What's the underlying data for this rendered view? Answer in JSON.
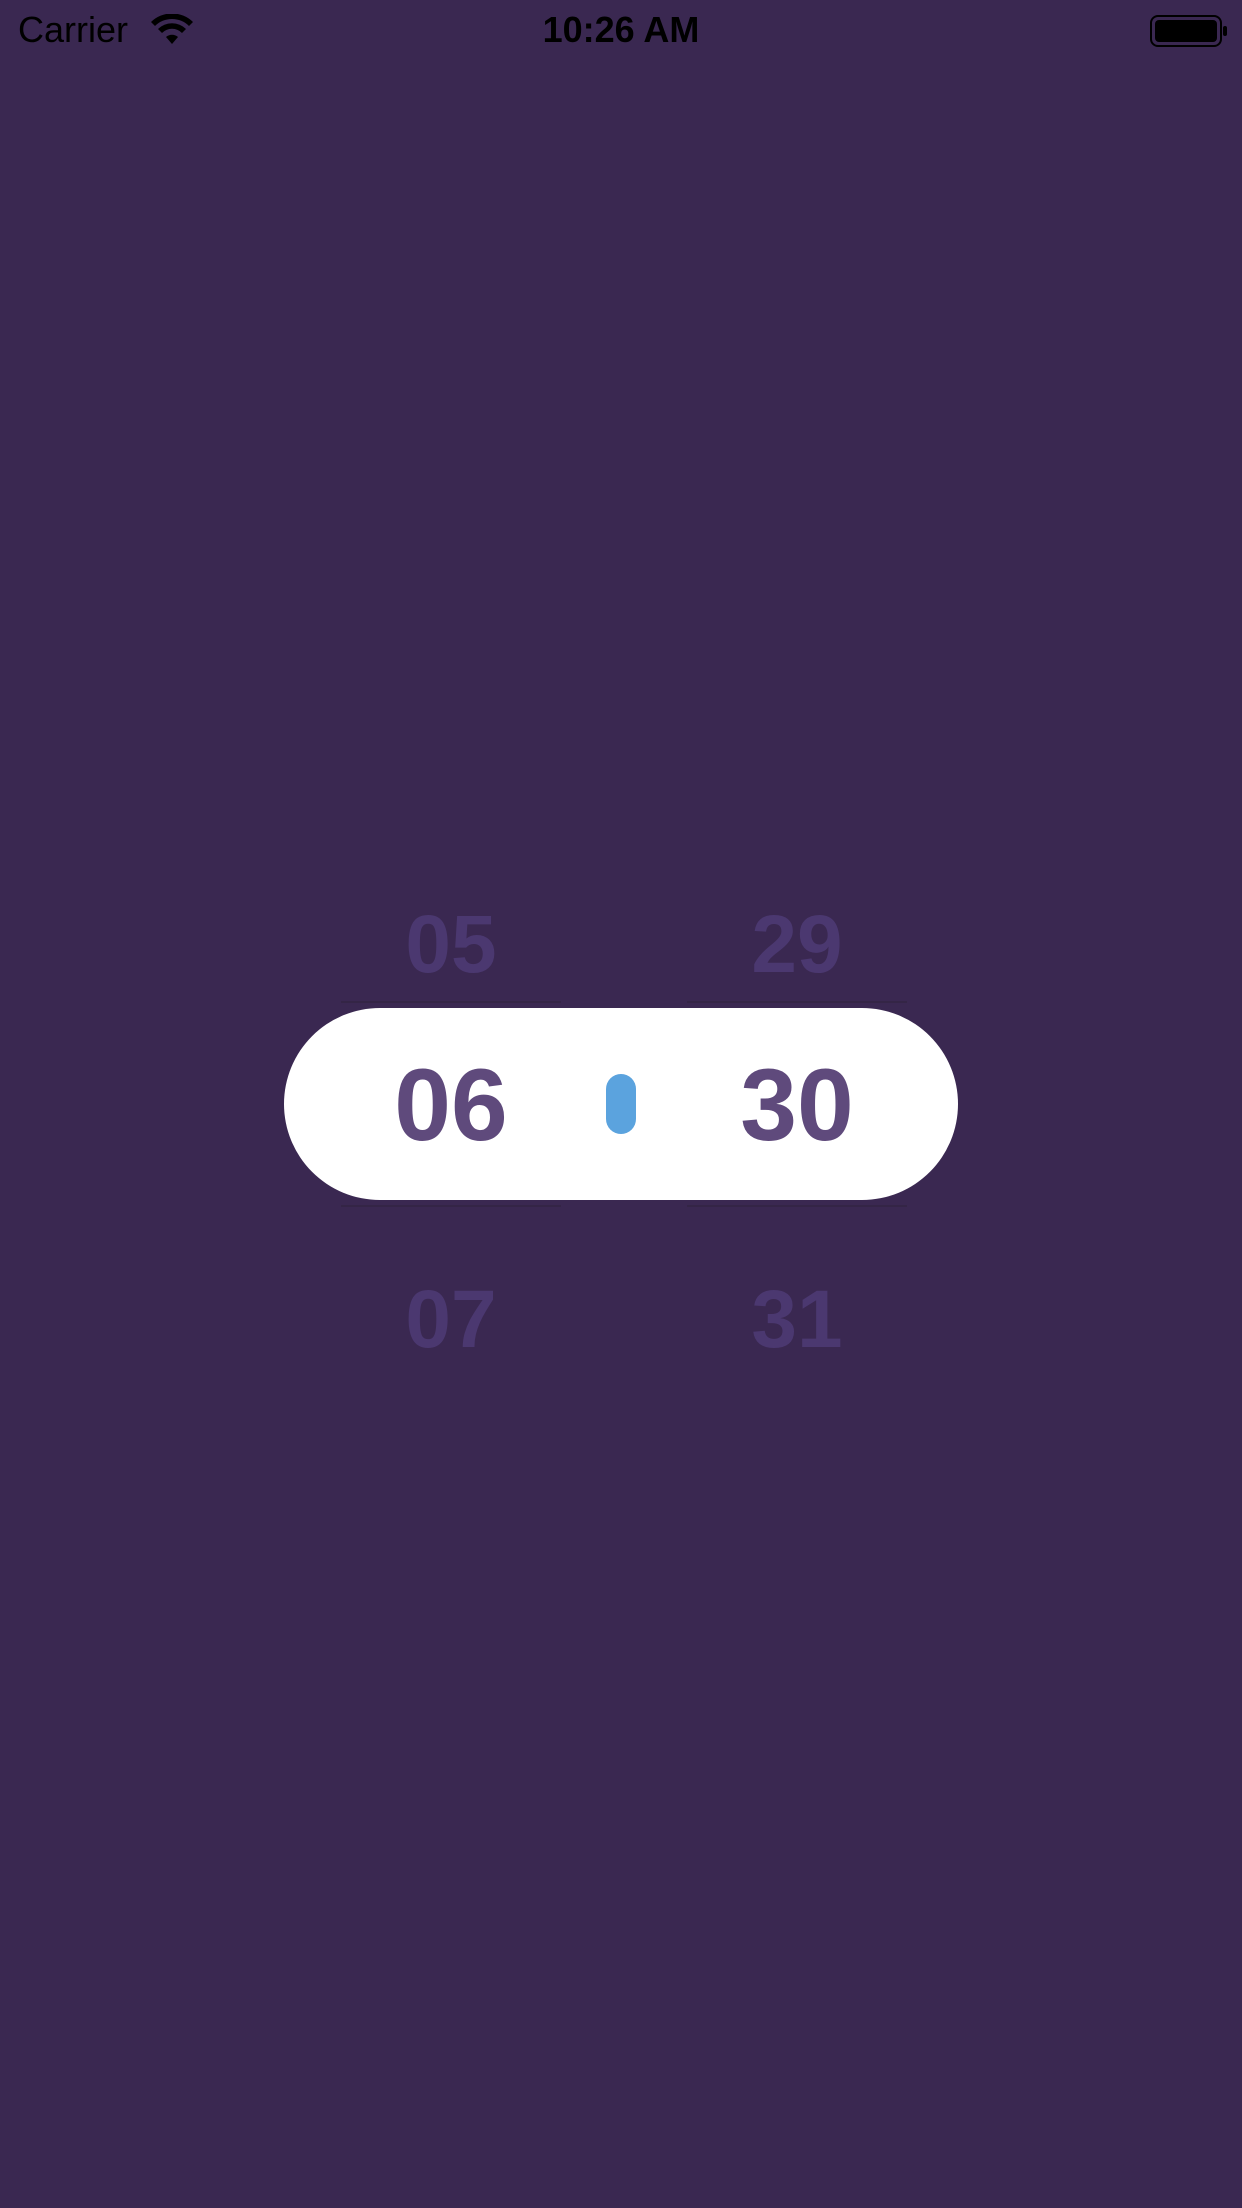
{
  "status_bar": {
    "carrier": "Carrier",
    "time": "10:26 AM",
    "icons": [
      "wifi-icon",
      "battery-icon"
    ]
  },
  "time_picker": {
    "hours": {
      "previous": "05",
      "selected": "06",
      "next": "07"
    },
    "minutes": {
      "previous": "29",
      "selected": "30",
      "next": "31"
    },
    "colors": {
      "background": "#3a2851",
      "pill": "#ffffff",
      "selected_text": "#5f4a7c",
      "faded_text": "#4b3870",
      "separator": "#5ba3de"
    }
  }
}
